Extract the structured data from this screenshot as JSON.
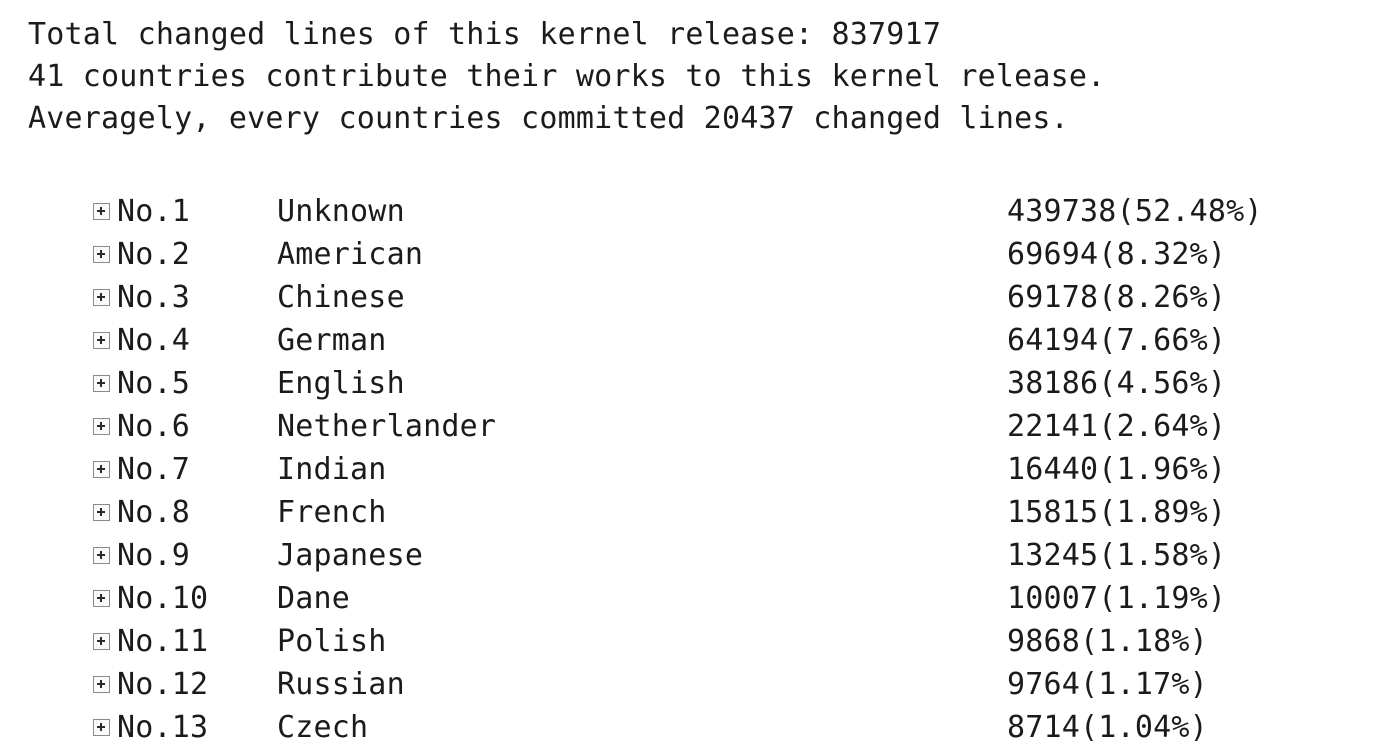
{
  "summary": {
    "lines": [
      "Total changed lines of this kernel release: 837917",
      "41 countries contribute their works to this kernel release.",
      "Averagely, every countries committed 20437 changed lines."
    ],
    "total_changed_lines": 837917,
    "country_count": 41,
    "average_changed_lines": 20437
  },
  "list": {
    "expander_icon": "plus-box-icon",
    "rows": [
      {
        "rank": "No.1",
        "name": "Unknown",
        "value": "439738(52.48%)",
        "lines": 439738,
        "percent": 52.48
      },
      {
        "rank": "No.2",
        "name": "American",
        "value": "69694(8.32%)",
        "lines": 69694,
        "percent": 8.32
      },
      {
        "rank": "No.3",
        "name": "Chinese",
        "value": "69178(8.26%)",
        "lines": 69178,
        "percent": 8.26
      },
      {
        "rank": "No.4",
        "name": "German",
        "value": "64194(7.66%)",
        "lines": 64194,
        "percent": 7.66
      },
      {
        "rank": "No.5",
        "name": "English",
        "value": "38186(4.56%)",
        "lines": 38186,
        "percent": 4.56
      },
      {
        "rank": "No.6",
        "name": "Netherlander",
        "value": "22141(2.64%)",
        "lines": 22141,
        "percent": 2.64
      },
      {
        "rank": "No.7",
        "name": "Indian",
        "value": "16440(1.96%)",
        "lines": 16440,
        "percent": 1.96
      },
      {
        "rank": "No.8",
        "name": "French",
        "value": "15815(1.89%)",
        "lines": 15815,
        "percent": 1.89
      },
      {
        "rank": "No.9",
        "name": "Japanese",
        "value": "13245(1.58%)",
        "lines": 13245,
        "percent": 1.58
      },
      {
        "rank": "No.10",
        "name": "Dane",
        "value": "10007(1.19%)",
        "lines": 10007,
        "percent": 1.19
      },
      {
        "rank": "No.11",
        "name": "Polish",
        "value": "9868(1.18%)",
        "lines": 9868,
        "percent": 1.18
      },
      {
        "rank": "No.12",
        "name": "Russian",
        "value": "9764(1.17%)",
        "lines": 9764,
        "percent": 1.17
      },
      {
        "rank": "No.13",
        "name": "Czech",
        "value": "8714(1.04%)",
        "lines": 8714,
        "percent": 1.04
      }
    ]
  },
  "colors": {
    "background": "#ffffff",
    "text": "#1b1b1b",
    "expander_border": "#8a8a8a"
  }
}
